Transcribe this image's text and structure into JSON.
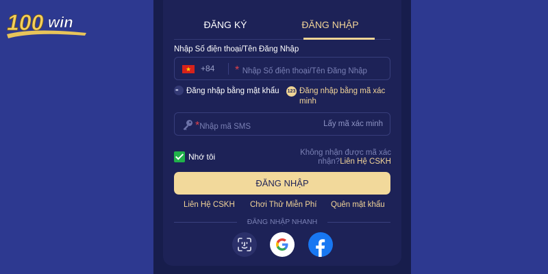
{
  "logo": {
    "text": "100win"
  },
  "tabs": [
    {
      "label": "ĐĂNG KÝ",
      "active": false
    },
    {
      "label": "ĐĂNG NHẬP",
      "active": true
    }
  ],
  "form": {
    "phone_label": "Nhập Số điện thoại/Tên Đăng Nhập",
    "country_code": "+84",
    "required_mark": "*",
    "phone_placeholder": "Nhập Số điện thoại/Tên Đăng Nhập",
    "method_password": "Đăng nhập bằng mật khẩu",
    "method_sms_badge": "123",
    "method_sms": "Đăng nhập bằng mã xác minh",
    "sms_placeholder": "Nhập mã SMS",
    "get_code": "Lấy mã xác minh",
    "remember_me": "Nhớ tôi",
    "remember_checked": true,
    "help_text": "Không nhận được mã xác nhận?",
    "help_link": "Liên Hệ CSKH",
    "login_button": "ĐĂNG NHẬP"
  },
  "links": [
    "Liên Hệ CSKH",
    "Chơi Thử Miễn Phí",
    "Quên mật khẩu"
  ],
  "quick_login": {
    "label": "ĐĂNG NHẬP NHANH",
    "providers": [
      "face-id-icon",
      "google-icon",
      "facebook-icon"
    ]
  },
  "colors": {
    "background": "#2d3990",
    "panel": "#1d2257",
    "accent": "#f2d99b",
    "check": "#20b14a"
  }
}
